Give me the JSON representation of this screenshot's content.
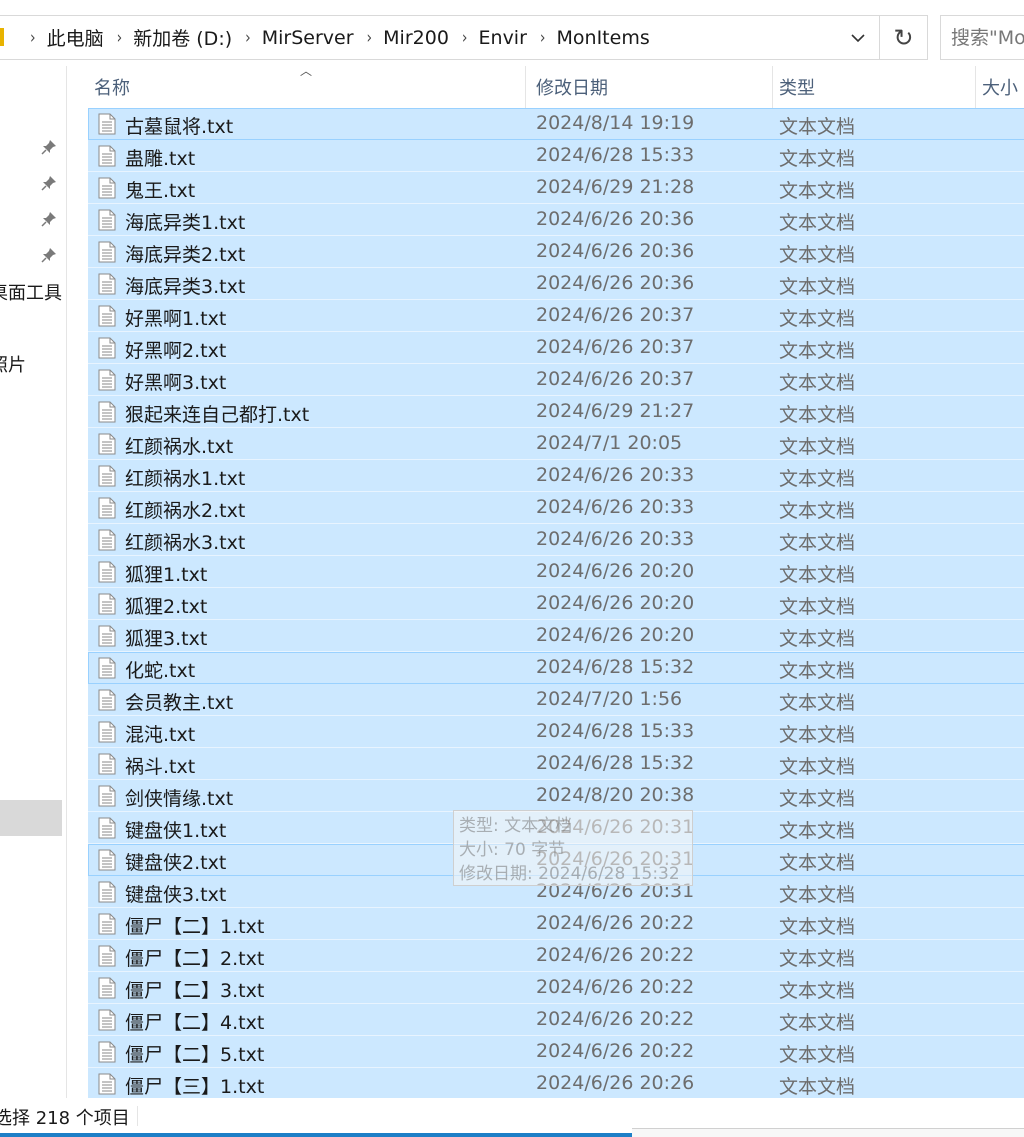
{
  "address": {
    "crumbs": [
      "此电脑",
      "新加卷 (D:)",
      "MirServer",
      "Mir200",
      "Envir",
      "MonItems"
    ],
    "separator": "›"
  },
  "search": {
    "placeholder": "搜索\"MonItems\""
  },
  "refresh_glyph": "↻",
  "nav": {
    "items": [
      {
        "label": "桌面工具"
      },
      {
        "label": "照片"
      }
    ]
  },
  "columns": {
    "name": "名称",
    "date": "修改日期",
    "type": "类型",
    "size": "大小"
  },
  "files": [
    {
      "name": "古墓鼠将.txt",
      "date": "2024/8/14 19:19",
      "type": "文本文档"
    },
    {
      "name": "蛊雕.txt",
      "date": "2024/6/28 15:33",
      "type": "文本文档"
    },
    {
      "name": "鬼王.txt",
      "date": "2024/6/29 21:28",
      "type": "文本文档"
    },
    {
      "name": "海底异类1.txt",
      "date": "2024/6/26 20:36",
      "type": "文本文档"
    },
    {
      "name": "海底异类2.txt",
      "date": "2024/6/26 20:36",
      "type": "文本文档"
    },
    {
      "name": "海底异类3.txt",
      "date": "2024/6/26 20:36",
      "type": "文本文档"
    },
    {
      "name": "好黑啊1.txt",
      "date": "2024/6/26 20:37",
      "type": "文本文档"
    },
    {
      "name": "好黑啊2.txt",
      "date": "2024/6/26 20:37",
      "type": "文本文档"
    },
    {
      "name": "好黑啊3.txt",
      "date": "2024/6/26 20:37",
      "type": "文本文档"
    },
    {
      "name": "狠起来连自己都打.txt",
      "date": "2024/6/29 21:27",
      "type": "文本文档"
    },
    {
      "name": "红颜祸水.txt",
      "date": "2024/7/1 20:05",
      "type": "文本文档"
    },
    {
      "name": "红颜祸水1.txt",
      "date": "2024/6/26 20:33",
      "type": "文本文档"
    },
    {
      "name": "红颜祸水2.txt",
      "date": "2024/6/26 20:33",
      "type": "文本文档"
    },
    {
      "name": "红颜祸水3.txt",
      "date": "2024/6/26 20:33",
      "type": "文本文档"
    },
    {
      "name": "狐狸1.txt",
      "date": "2024/6/26 20:20",
      "type": "文本文档"
    },
    {
      "name": "狐狸2.txt",
      "date": "2024/6/26 20:20",
      "type": "文本文档"
    },
    {
      "name": "狐狸3.txt",
      "date": "2024/6/26 20:20",
      "type": "文本文档"
    },
    {
      "name": "化蛇.txt",
      "date": "2024/6/28 15:32",
      "type": "文本文档"
    },
    {
      "name": "会员教主.txt",
      "date": "2024/7/20 1:56",
      "type": "文本文档"
    },
    {
      "name": "混沌.txt",
      "date": "2024/6/28 15:33",
      "type": "文本文档"
    },
    {
      "name": "祸斗.txt",
      "date": "2024/6/28 15:32",
      "type": "文本文档"
    },
    {
      "name": "剑侠情缘.txt",
      "date": "2024/8/20 20:38",
      "type": "文本文档"
    },
    {
      "name": "键盘侠1.txt",
      "date": "2024/6/26 20:31",
      "type": "文本文档"
    },
    {
      "name": "键盘侠2.txt",
      "date": "2024/6/26 20:31",
      "type": "文本文档"
    },
    {
      "name": "键盘侠3.txt",
      "date": "2024/6/26 20:31",
      "type": "文本文档"
    },
    {
      "name": "僵尸【二】1.txt",
      "date": "2024/6/26 20:22",
      "type": "文本文档"
    },
    {
      "name": "僵尸【二】2.txt",
      "date": "2024/6/26 20:22",
      "type": "文本文档"
    },
    {
      "name": "僵尸【二】3.txt",
      "date": "2024/6/26 20:22",
      "type": "文本文档"
    },
    {
      "name": "僵尸【二】4.txt",
      "date": "2024/6/26 20:22",
      "type": "文本文档"
    },
    {
      "name": "僵尸【二】5.txt",
      "date": "2024/6/26 20:22",
      "type": "文本文档"
    },
    {
      "name": "僵尸【三】1.txt",
      "date": "2024/6/26 20:26",
      "type": "文本文档"
    }
  ],
  "tooltip": {
    "type_line": "类型: 文本文档",
    "size_line": "大小: 70 字节",
    "date_line": "修改日期: 2024/6/28 15:32"
  },
  "status": {
    "text": "选择 218 个项目"
  },
  "colors": {
    "selection": "#cce8ff",
    "header_text": "#4c607a",
    "taskbar": "#1d7fc7"
  }
}
